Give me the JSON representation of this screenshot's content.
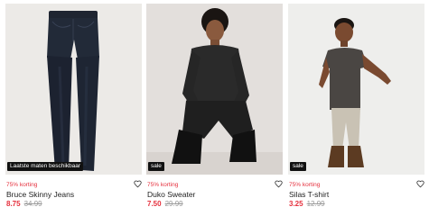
{
  "products": [
    {
      "badge": "Laatste maten beschikbaar",
      "promo": "75% korting",
      "name": "Bruce Skinny Jeans",
      "price_now": "8.75",
      "price_old": "34.99",
      "icon": "heart-icon"
    },
    {
      "badge": "sale",
      "promo": "75% korting",
      "name": "Duko Sweater",
      "price_now": "7.50",
      "price_old": "29.99",
      "icon": "heart-icon"
    },
    {
      "badge": "sale",
      "promo": "75% korting",
      "name": "Silas T-shirt",
      "price_now": "3.25",
      "price_old": "12.99",
      "icon": "heart-icon"
    }
  ],
  "colors": {
    "accent_red": "#e5303d",
    "badge_bg": "#111111",
    "strike_gray": "#9a9a9a"
  }
}
